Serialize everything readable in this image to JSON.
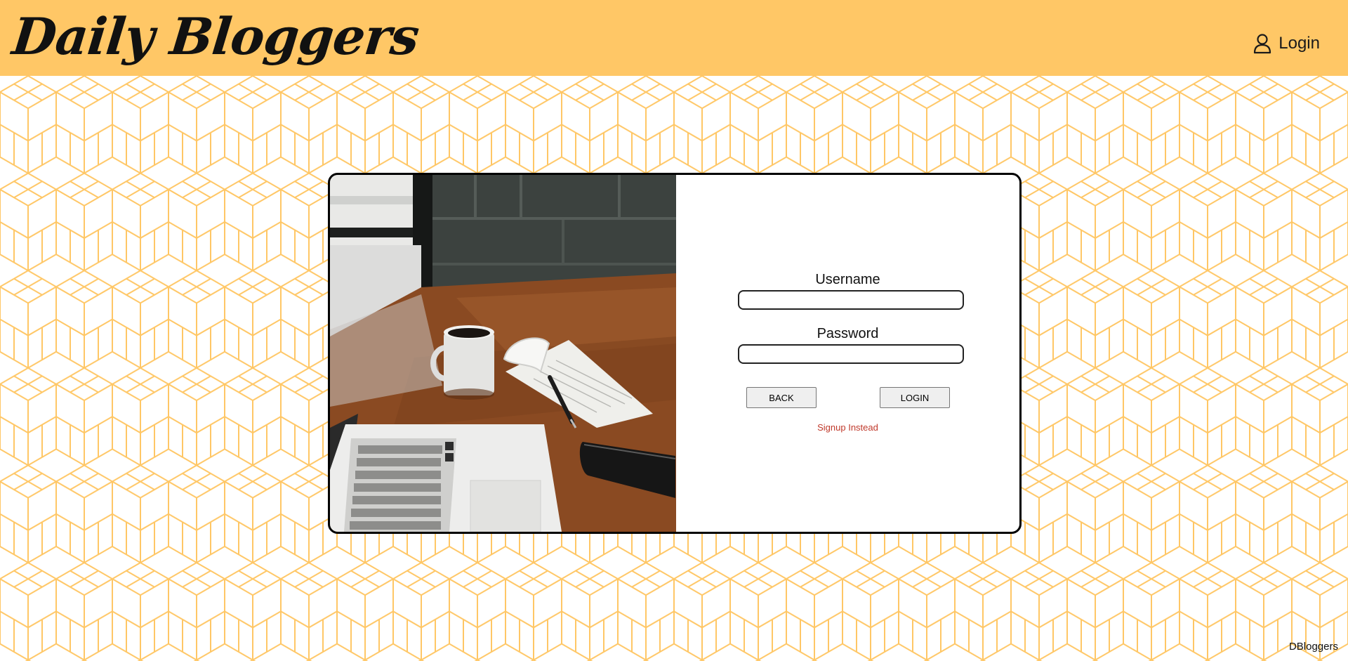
{
  "header": {
    "brand": "Daily Bloggers",
    "nav_login_label": "Login",
    "nav_login_icon": "user-icon",
    "background_color": "#ffc766"
  },
  "background": {
    "pattern": "isometric-cube-lines",
    "line_color": "#ffc766"
  },
  "login_card": {
    "image": "desk-with-laptop-coffee-mug-notepad-phone",
    "username_label": "Username",
    "username_value": "",
    "password_label": "Password",
    "password_value": "",
    "back_button_label": "BACK",
    "login_button_label": "LOGIN",
    "signup_link_label": "Signup Instead",
    "signup_link_color": "#c0392b"
  },
  "footer": {
    "text": "DBloggers"
  }
}
